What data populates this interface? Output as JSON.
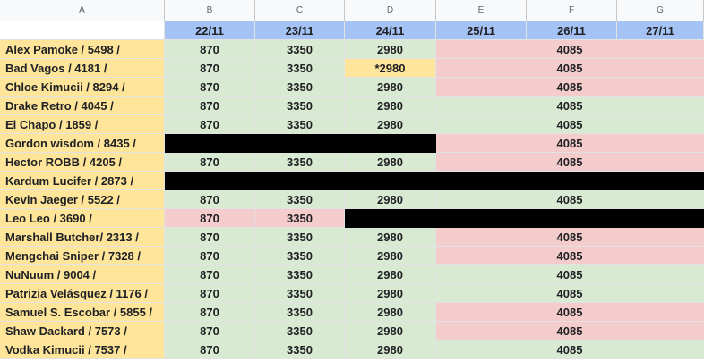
{
  "columns": [
    "A",
    "B",
    "C",
    "D",
    "E",
    "F",
    "G"
  ],
  "dates": [
    "22/11",
    "23/11",
    "24/11",
    "25/11",
    "26/11",
    "27/11"
  ],
  "rows": [
    {
      "name": "Alex Pamoke / 5498 /",
      "b": "870",
      "c": "3350",
      "d": "2980",
      "f": "4085"
    },
    {
      "name": "Bad Vagos / 4181 /",
      "b": "870",
      "c": "3350",
      "d": "*2980",
      "f": "4085"
    },
    {
      "name": "Chloe Kimucii / 8294 /",
      "b": "870",
      "c": "3350",
      "d": "2980",
      "f": "4085"
    },
    {
      "name": "Drake Retro / 4045 /",
      "b": "870",
      "c": "3350",
      "d": "2980",
      "f": "4085"
    },
    {
      "name": "El Chapo / 1859 /",
      "b": "870",
      "c": "3350",
      "d": "2980",
      "f": "4085"
    },
    {
      "name": "Gordon wisdom / 8435 /",
      "f": "4085"
    },
    {
      "name": "Hector ROBB / 4205 /",
      "b": "870",
      "c": "3350",
      "d": "2980",
      "f": "4085"
    },
    {
      "name": "Kardum Lucifer / 2873 /"
    },
    {
      "name": "Kevin Jaeger / 5522 /",
      "b": "870",
      "c": "3350",
      "d": "2980",
      "f": "4085"
    },
    {
      "name": "Leo Leo / 3690 /",
      "b": "870",
      "c": "3350"
    },
    {
      "name": "Marshall Butcher/ 2313 /",
      "b": "870",
      "c": "3350",
      "d": "2980",
      "f": "4085"
    },
    {
      "name": "Mengchai Sniper / 7328 /",
      "b": "870",
      "c": "3350",
      "d": "2980",
      "f": "4085"
    },
    {
      "name": "NuNuum / 9004 /",
      "b": "870",
      "c": "3350",
      "d": "2980",
      "f": "4085"
    },
    {
      "name": "Patrizia Velásquez / 1176 /",
      "b": "870",
      "c": "3350",
      "d": "2980",
      "f": "4085"
    },
    {
      "name": "Samuel S. Escobar / 5855 /",
      "b": "870",
      "c": "3350",
      "d": "2980",
      "f": "4085"
    },
    {
      "name": "Shaw Dackard / 7573 /",
      "b": "870",
      "c": "3350",
      "d": "2980",
      "f": "4085"
    },
    {
      "name": "Vodka Kimucii / 7537 /",
      "b": "870",
      "c": "3350",
      "d": "2980",
      "f": "4085"
    }
  ],
  "colors": {
    "paid_green": "#d9ead3",
    "unpaid_pink": "#f4cccc",
    "name_yellow": "#ffe599",
    "note_orange": "#fce5cd",
    "header_blue": "#a4c2f4",
    "blocked_black": "#000000"
  }
}
